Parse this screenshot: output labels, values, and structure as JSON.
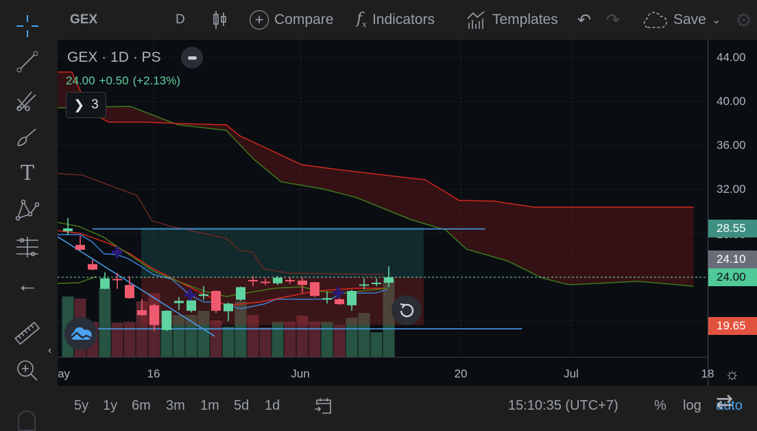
{
  "topbar": {
    "symbol": "GEX",
    "interval": "D",
    "compare": "Compare",
    "indicators": "Indicators",
    "templates": "Templates",
    "save": "Save"
  },
  "legend": {
    "title": "GEX · 1D · PS",
    "price": "24.00",
    "change": "+0.50",
    "change_pct": "(+2.13%)",
    "collapsed_count": "3"
  },
  "price_axis": {
    "ticks": [
      "44.00",
      "40.00",
      "36.00",
      "32.00",
      "28.00"
    ],
    "badges": [
      {
        "label": "28.55",
        "color": "#3d8f82",
        "text": "#ffffff"
      },
      {
        "label": "24.10",
        "color": "#6a6d78",
        "text": "#ffffff"
      },
      {
        "label": "24.00",
        "color": "#4fc998",
        "text": "#0a0d12"
      },
      {
        "label": "19.65",
        "color": "#e2533f",
        "text": "#ffffff"
      }
    ]
  },
  "time_axis": {
    "ticks": [
      "May",
      "16",
      "Jun",
      "20",
      "Jul",
      "18"
    ]
  },
  "bottombar": {
    "ranges": [
      "5y",
      "1y",
      "6m",
      "3m",
      "1m",
      "5d",
      "1d"
    ],
    "clock": "15:10:35 (UTC+7)",
    "percent": "%",
    "log": "log",
    "auto": "auto"
  },
  "colors": {
    "up": "#5fd3a0",
    "down": "#ef5a6f",
    "accent": "#2196f3"
  },
  "chart_data": {
    "type": "candlestick",
    "ylim": [
      17,
      46
    ],
    "candles": [
      [
        28.2,
        29.4,
        27.9,
        28.45
      ],
      [
        26.95,
        27.75,
        26.45,
        26.5
      ],
      [
        25.2,
        25.6,
        24.65,
        24.7
      ],
      [
        22.95,
        24.45,
        22.9,
        23.9
      ],
      [
        23.85,
        24.4,
        22.95,
        23.75
      ],
      [
        23.3,
        24.1,
        22.05,
        22.1
      ],
      [
        21.0,
        22.0,
        20.5,
        20.55
      ],
      [
        21.45,
        21.6,
        19.1,
        19.65
      ],
      [
        19.2,
        21.0,
        19.1,
        20.95
      ],
      [
        21.65,
        22.2,
        21.0,
        21.85
      ],
      [
        20.95,
        22.7,
        20.8,
        21.9
      ],
      [
        22.3,
        23.2,
        21.95,
        22.45
      ],
      [
        22.75,
        22.8,
        20.75,
        20.95
      ],
      [
        20.9,
        21.7,
        20.0,
        21.6
      ],
      [
        21.95,
        23.15,
        21.85,
        23.1
      ],
      [
        23.75,
        24.1,
        23.2,
        23.65
      ],
      [
        23.6,
        23.9,
        23.3,
        23.5
      ],
      [
        23.45,
        24.1,
        23.3,
        23.95
      ],
      [
        23.75,
        24.0,
        23.4,
        23.65
      ],
      [
        23.7,
        24.0,
        22.55,
        23.3
      ],
      [
        23.55,
        23.6,
        22.2,
        22.3
      ],
      [
        22.0,
        22.7,
        21.6,
        22.1
      ],
      [
        22.0,
        22.6,
        21.5,
        21.55
      ],
      [
        21.45,
        22.85,
        20.95,
        22.75
      ],
      [
        23.25,
        23.9,
        22.9,
        23.35
      ],
      [
        23.4,
        23.9,
        23.2,
        23.5
      ],
      [
        23.5,
        25.0,
        23.1,
        24.0
      ]
    ],
    "volume_relative": [
      88,
      85,
      51,
      100,
      50,
      51,
      81,
      93,
      67,
      61,
      61,
      67,
      53,
      44,
      81,
      61,
      43,
      51,
      51,
      60,
      51,
      51,
      47,
      57,
      64,
      36,
      113
    ],
    "lines": [
      {
        "name": "cloud-span-a",
        "color": "#3d7a1e",
        "points": [
          [
            -0.83,
            39.44
          ],
          [
            5.06,
            39.56
          ],
          [
            8.94,
            37.88
          ],
          [
            12.83,
            37.38
          ],
          [
            15.06,
            34.75
          ],
          [
            17.28,
            32.69
          ],
          [
            20.6,
            32.06
          ],
          [
            23.4,
            31.25
          ],
          [
            27.8,
            29.25
          ],
          [
            30.6,
            28.31
          ],
          [
            32.3,
            26.56
          ],
          [
            35.6,
            25.5
          ],
          [
            38.4,
            23.94
          ],
          [
            40.6,
            23.31
          ],
          [
            46.2,
            23.63
          ],
          [
            50.7,
            23.19
          ]
        ]
      },
      {
        "name": "cloud-span-b",
        "color": "#d0281f",
        "points": [
          [
            -0.83,
            42.69
          ],
          [
            0.33,
            42.69
          ],
          [
            1.44,
            39.88
          ],
          [
            2,
            38.94
          ],
          [
            3.28,
            38.13
          ],
          [
            6.17,
            38.13
          ],
          [
            8.94,
            38.0
          ],
          [
            12.83,
            37.88
          ],
          [
            13.94,
            36.88
          ],
          [
            18.94,
            34.25
          ],
          [
            22.28,
            33.75
          ],
          [
            28.94,
            32.88
          ],
          [
            31.7,
            31.0
          ],
          [
            34.5,
            30.94
          ],
          [
            37.8,
            30.38
          ],
          [
            50.7,
            30.38
          ]
        ]
      },
      {
        "name": "lagging-line",
        "color": "#6b2a22",
        "points": [
          [
            -0.83,
            33.44
          ],
          [
            1.17,
            33.31
          ],
          [
            5.6,
            31.44
          ],
          [
            6.83,
            29.13
          ],
          [
            8.39,
            28.63
          ],
          [
            12.28,
            27.69
          ],
          [
            12.83,
            27.56
          ],
          [
            13.94,
            26.44
          ],
          [
            14.94,
            26.31
          ],
          [
            15.89,
            24.75
          ],
          [
            17.83,
            24.38
          ],
          [
            25.6,
            24.25
          ]
        ]
      },
      {
        "name": "conversion-line",
        "color": "#3d7fd4",
        "points": [
          [
            -0.83,
            27.88
          ],
          [
            1,
            27.88
          ],
          [
            1.94,
            27.25
          ],
          [
            2.94,
            26.13
          ],
          [
            4,
            26.06
          ],
          [
            4.89,
            25.69
          ],
          [
            5.83,
            25.06
          ],
          [
            6.94,
            24.25
          ],
          [
            8.44,
            23.81
          ],
          [
            9.89,
            22.38
          ],
          [
            11,
            21.75
          ],
          [
            12.11,
            21.75
          ],
          [
            14,
            21.13
          ],
          [
            15.89,
            21.56
          ],
          [
            16.89,
            22.0
          ],
          [
            21.33,
            22.0
          ],
          [
            22.11,
            22.56
          ],
          [
            24.89,
            22.56
          ],
          [
            25.89,
            22.88
          ]
        ]
      },
      {
        "name": "base-line",
        "color": "#d9291f",
        "points": [
          [
            -0.83,
            28.25
          ],
          [
            1,
            28.0
          ],
          [
            3.39,
            27.06
          ],
          [
            5.06,
            26.13
          ],
          [
            6.72,
            24.88
          ],
          [
            8.94,
            23.63
          ],
          [
            11.17,
            22.38
          ],
          [
            12.83,
            21.44
          ],
          [
            15.61,
            21.75
          ],
          [
            17.83,
            22.25
          ],
          [
            20.06,
            22.75
          ],
          [
            23.39,
            23.0
          ],
          [
            25.89,
            23.0
          ]
        ]
      },
      {
        "name": "moving-average-line",
        "color": "#4a7a18",
        "points": [
          [
            -0.83,
            29.0
          ],
          [
            0.89,
            28.63
          ],
          [
            2.83,
            27.69
          ],
          [
            5.06,
            26.0
          ],
          [
            6.94,
            24.56
          ],
          [
            8.94,
            23.63
          ],
          [
            11.17,
            22.69
          ],
          [
            12.83,
            22.25
          ],
          [
            16.72,
            23.0
          ],
          [
            18.94,
            23.13
          ],
          [
            20.61,
            22.69
          ],
          [
            22.28,
            22.56
          ],
          [
            25.89,
            23.0
          ]
        ]
      },
      {
        "name": "chikou-line",
        "color": "#4a7a18",
        "points": [
          [
            -0.83,
            23.44
          ],
          [
            0.89,
            23.5
          ],
          [
            2.28,
            24.06
          ]
        ]
      }
    ],
    "trendline": [
      [
        -0.83,
        27.69
      ],
      [
        11.89,
        18.63
      ]
    ],
    "horizontal_lines": [
      {
        "price": 28.4,
        "from": 2,
        "to": 33.8
      },
      {
        "price": 19.3,
        "from": 2.44,
        "to": 36.8
      }
    ],
    "position_box": {
      "from": 5.94,
      "to": 28.83,
      "target": 28.55,
      "entry": 24.0,
      "stop": 19.65
    },
    "markers": [
      [
        4,
        26.3
      ],
      [
        9.9,
        22.4
      ],
      [
        21.9,
        22.6
      ]
    ],
    "last_price": 24.0
  }
}
